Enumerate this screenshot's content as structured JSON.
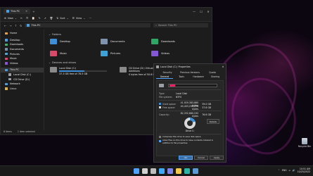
{
  "explorer": {
    "tab_title": "This PC",
    "command_bar": {
      "new_label": "New",
      "sort_label": "Sort",
      "view_label": "View"
    },
    "address": "This PC",
    "search_placeholder": "Search This PC",
    "sidebar": [
      {
        "label": "Home",
        "icon": "home-icon",
        "color": "#e8a33d"
      },
      {
        "label": "Desktop",
        "icon": "desktop-icon",
        "color": "#4a9fe0"
      },
      {
        "label": "Downloads",
        "icon": "download-icon",
        "color": "#3ab56a"
      },
      {
        "label": "Documents",
        "icon": "document-icon",
        "color": "#7a8ea8"
      },
      {
        "label": "Pictures",
        "icon": "picture-icon",
        "color": "#4aa8d8"
      },
      {
        "label": "Music",
        "icon": "music-icon",
        "color": "#e0476b"
      },
      {
        "label": "Videos",
        "icon": "video-icon",
        "color": "#8a54d8"
      },
      {
        "label": "This PC",
        "icon": "pc-icon",
        "color": "#4a9fe0"
      },
      {
        "label": "Local Disk (C:)",
        "icon": "drive-icon",
        "color": "#9aa0a6"
      },
      {
        "label": "CD Drive (D:)",
        "icon": "cd-icon",
        "color": "#9aa0a6"
      },
      {
        "label": "Network",
        "icon": "network-icon",
        "color": "#4a9fe0"
      },
      {
        "label": "Linux",
        "icon": "linux-icon",
        "color": "#e0b33d"
      }
    ],
    "folders_section": "Folders",
    "folders": [
      {
        "label": "Desktop",
        "color": "#3d8fd8"
      },
      {
        "label": "Documents",
        "color": "#7f93ad"
      },
      {
        "label": "Downloads",
        "color": "#2fa866"
      },
      {
        "label": "Music",
        "color": "#d94a6a"
      },
      {
        "label": "Pictures",
        "color": "#3fa2d6"
      },
      {
        "label": "Videos",
        "color": "#8556d6"
      }
    ],
    "drives_section": "Devices and drives",
    "drives": [
      {
        "name": "Local Disk (C:)",
        "free": "37.3 GB free of 78.5 GB",
        "used_fraction": 0.53
      },
      {
        "name": "CD Drive (D:) VirtualBox Guest Additions",
        "free": "0 bytes free of 50.6 MB",
        "used_fraction": 1.0
      }
    ],
    "status": {
      "items": "8 items",
      "selected": "1 item selected"
    }
  },
  "properties": {
    "title": "Local Disk (C:) Properties",
    "tabs_row1": [
      "Security",
      "Previous Versions",
      "Quota"
    ],
    "tabs_row2": [
      "General",
      "Tools",
      "Hardware",
      "Sharing"
    ],
    "type_label": "Type:",
    "type_value": "Local Disk",
    "fs_label": "File system:",
    "fs_value": "NTFS",
    "used_label": "Used space:",
    "used_bytes": "41,929,383,680 bytes",
    "used_gb": "39.0 GB",
    "free_label": "Free space:",
    "free_bytes": "40,403,296,256 bytes",
    "free_gb": "37.6 GB",
    "cap_label": "Capacity:",
    "cap_bytes": "82,332,680,192 bytes",
    "cap_gb": "76.6 GB",
    "drive_label": "Drive C:",
    "cleanup_label": "Details",
    "compress_label": "Compress this drive to save disk space",
    "index_label": "Allow files on this drive to have contents indexed in addition to file properties",
    "ok": "OK",
    "cancel": "Cancel",
    "apply": "Apply",
    "used_color": "#3f8fd8",
    "free_color": "#d8d8d8"
  },
  "desktop": {
    "recycle_label": "Recycle Bin"
  },
  "taskbar": {
    "icons": [
      {
        "name": "start-icon",
        "color": "#4ea3ff"
      },
      {
        "name": "search-icon",
        "color": "#d0d0d0"
      },
      {
        "name": "task-view-icon",
        "color": "#bdbdbd"
      },
      {
        "name": "widgets-icon",
        "color": "#3fa9f5"
      },
      {
        "name": "chat-icon",
        "color": "#7b83eb"
      },
      {
        "name": "explorer-icon",
        "color": "#f2c94c"
      },
      {
        "name": "edge-icon",
        "color": "#2bb3a3"
      },
      {
        "name": "store-icon",
        "color": "#5b9bd5"
      }
    ],
    "lang": "ENG",
    "time": "10:51 AM",
    "date": "10/25/2022"
  }
}
